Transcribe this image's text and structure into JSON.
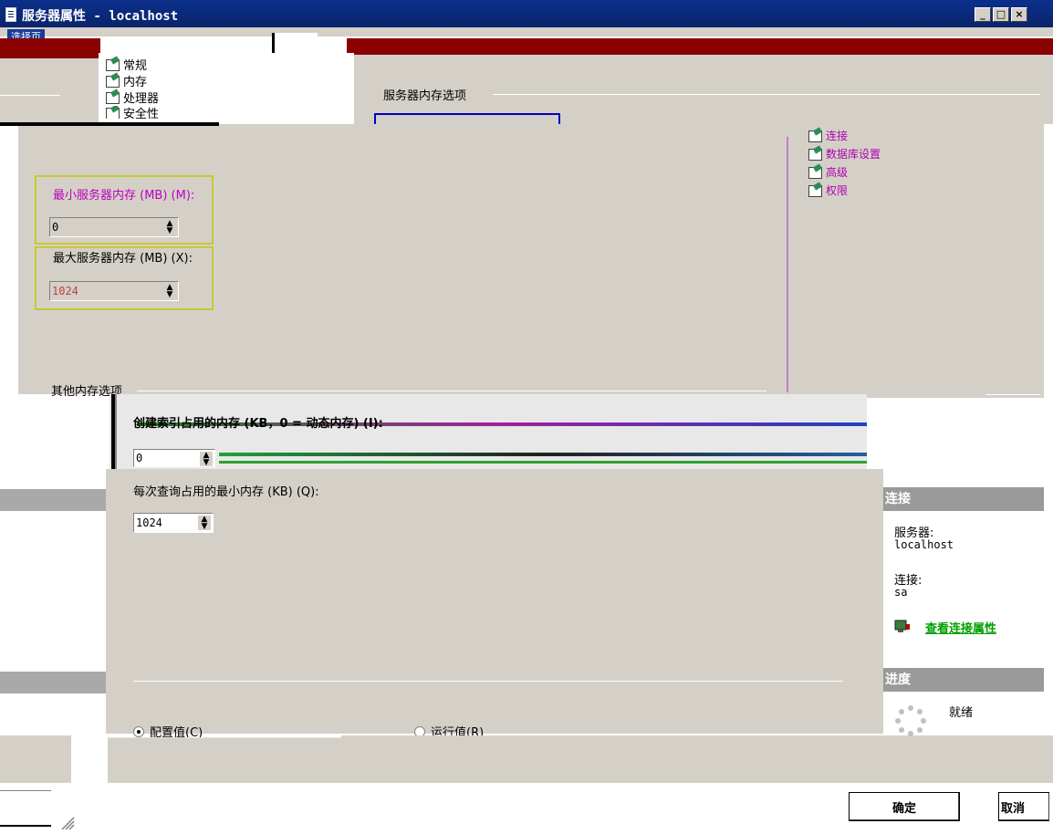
{
  "window": {
    "title": "服务器属性 - localhost",
    "controls": [
      "_",
      "□",
      "×"
    ]
  },
  "select_page": {
    "header": "选择页",
    "items": [
      {
        "label": "常规",
        "icon": "page-icon"
      },
      {
        "label": "内存",
        "icon": "page-icon"
      },
      {
        "label": "处理器",
        "icon": "page-icon"
      },
      {
        "label": "安全性",
        "icon": "page-icon"
      },
      {
        "label": "连接",
        "icon": "page-icon"
      },
      {
        "label": "数据库设置",
        "icon": "page-icon"
      },
      {
        "label": "高级",
        "icon": "page-icon"
      },
      {
        "label": "权限",
        "icon": "page-icon"
      }
    ]
  },
  "memory": {
    "server_memory_group": "服务器内存选项",
    "min_label": "最小服务器内存 (MB) (M):",
    "min_value": "0",
    "max_label": "最大服务器内存 (MB) (X):",
    "max_value": "1024",
    "other_group": "其他内存选项",
    "index_label": "创建索引占用的内存 (KB，0 = 动态内存) (I):",
    "index_value": "0",
    "query_label": "每次查询占用的最小内存 (KB) (Q):",
    "query_value": "1024",
    "radio_configured": "配置值(C)",
    "radio_running": "运行值(R)"
  },
  "connection": {
    "header": "连接",
    "server_label": "服务器:",
    "server_value": "localhost",
    "conn_label": "连接:",
    "conn_value": "sa",
    "view_link": "查看连接属性"
  },
  "progress": {
    "header": "进度",
    "status": "就绪"
  },
  "buttons": {
    "ok": "确定",
    "cancel": "取消"
  },
  "colors": {
    "title_bar": "#0a246a",
    "panel_bg": "#d4d0c8",
    "highlight_box": "#c8c832",
    "link": "#008000",
    "glitch_red": "#8b0000"
  }
}
